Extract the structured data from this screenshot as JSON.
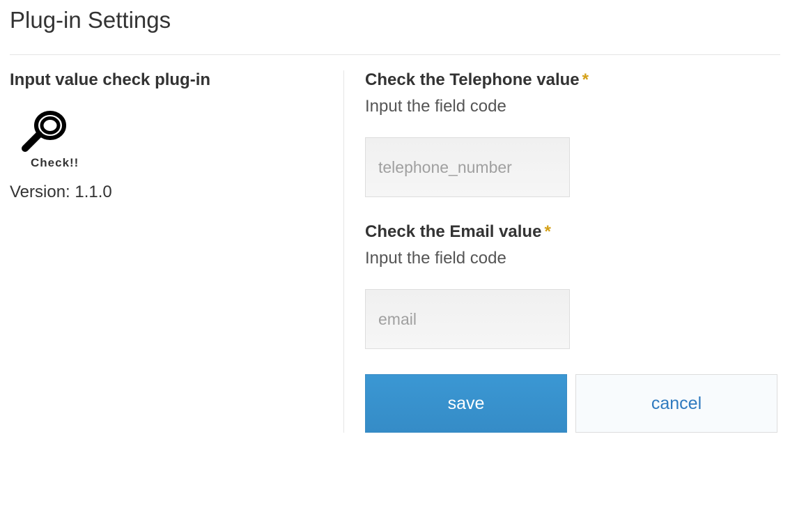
{
  "page_title": "Plug-in Settings",
  "plugin": {
    "name": "Input value check plug-in",
    "icon_caption": "Check!!",
    "version_label": "Version: 1.1.0"
  },
  "form": {
    "telephone": {
      "title": "Check the Telephone value",
      "desc": "Input the field code",
      "placeholder": "telephone_number",
      "value": ""
    },
    "email": {
      "title": "Check the Email value",
      "desc": "Input the field code",
      "placeholder": "email",
      "value": ""
    },
    "buttons": {
      "save": "save",
      "cancel": "cancel"
    }
  }
}
